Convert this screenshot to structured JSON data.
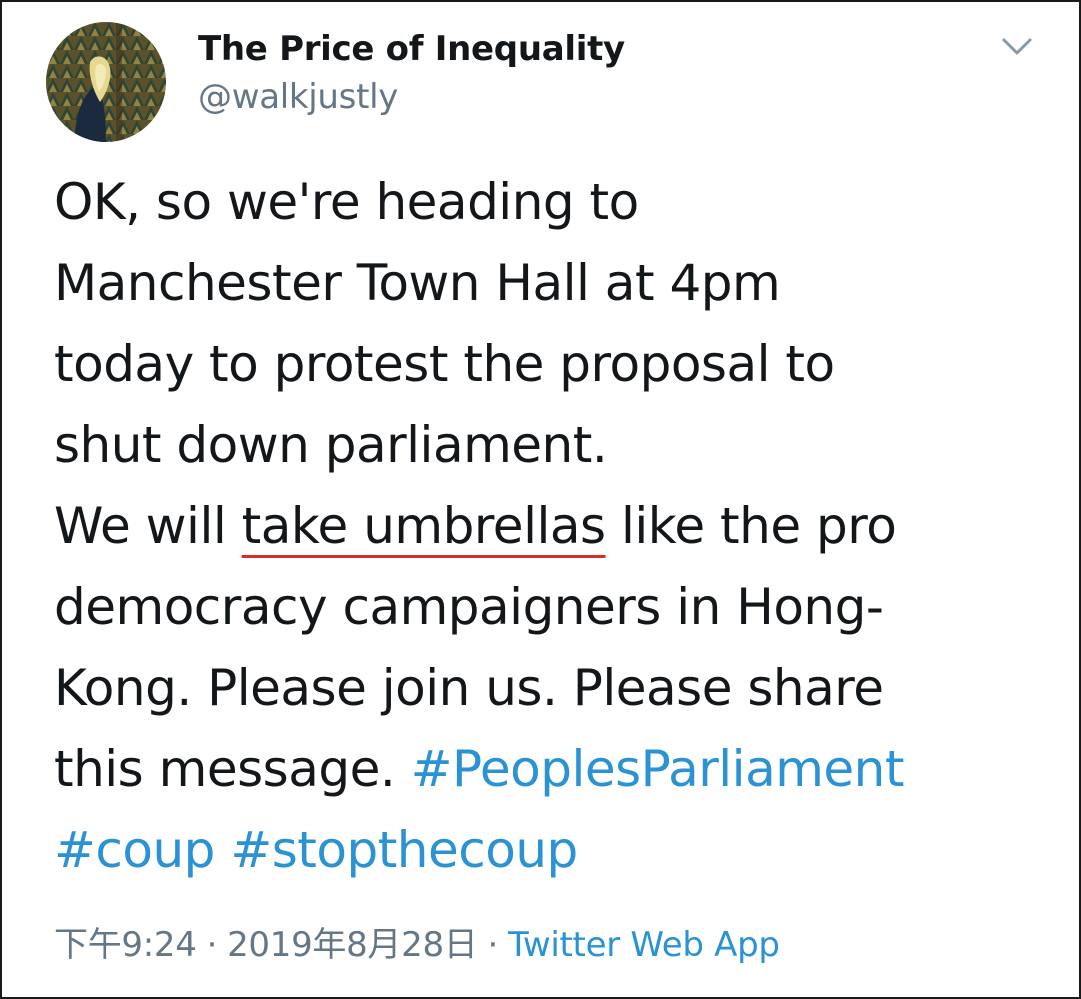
{
  "tweet": {
    "author": {
      "display_name": "The Price of Inequality",
      "handle": "@walkjustly",
      "avatar_icon": "profile-photo"
    },
    "menu_icon": "chevron-down-icon",
    "text_lines": {
      "l1": "OK, so we're heading to",
      "l2": "Manchester Town Hall at 4pm",
      "l3": "today to protest the proposal to",
      "l4": "shut down parliament.",
      "l5_before": "We will ",
      "l5_underlined": "take umbrellas",
      "l5_after": " like the pro",
      "l6": "democracy campaigners in Hong-",
      "l7": "Kong. Please join us. Please share",
      "l8_text": "this message. "
    },
    "hashtags": {
      "peoples_parliament": "#PeoplesParliament",
      "coup": "#coup",
      "stopthecoup": "#stopthecoup"
    },
    "meta": {
      "time": "下午9:24",
      "date": "2019年8月28日",
      "separator": "·",
      "source": "Twitter Web App"
    },
    "colors": {
      "link": "#2b92d3",
      "underline_mark": "#d42e2e",
      "secondary_text": "#657786",
      "primary_text": "#14171a"
    }
  }
}
